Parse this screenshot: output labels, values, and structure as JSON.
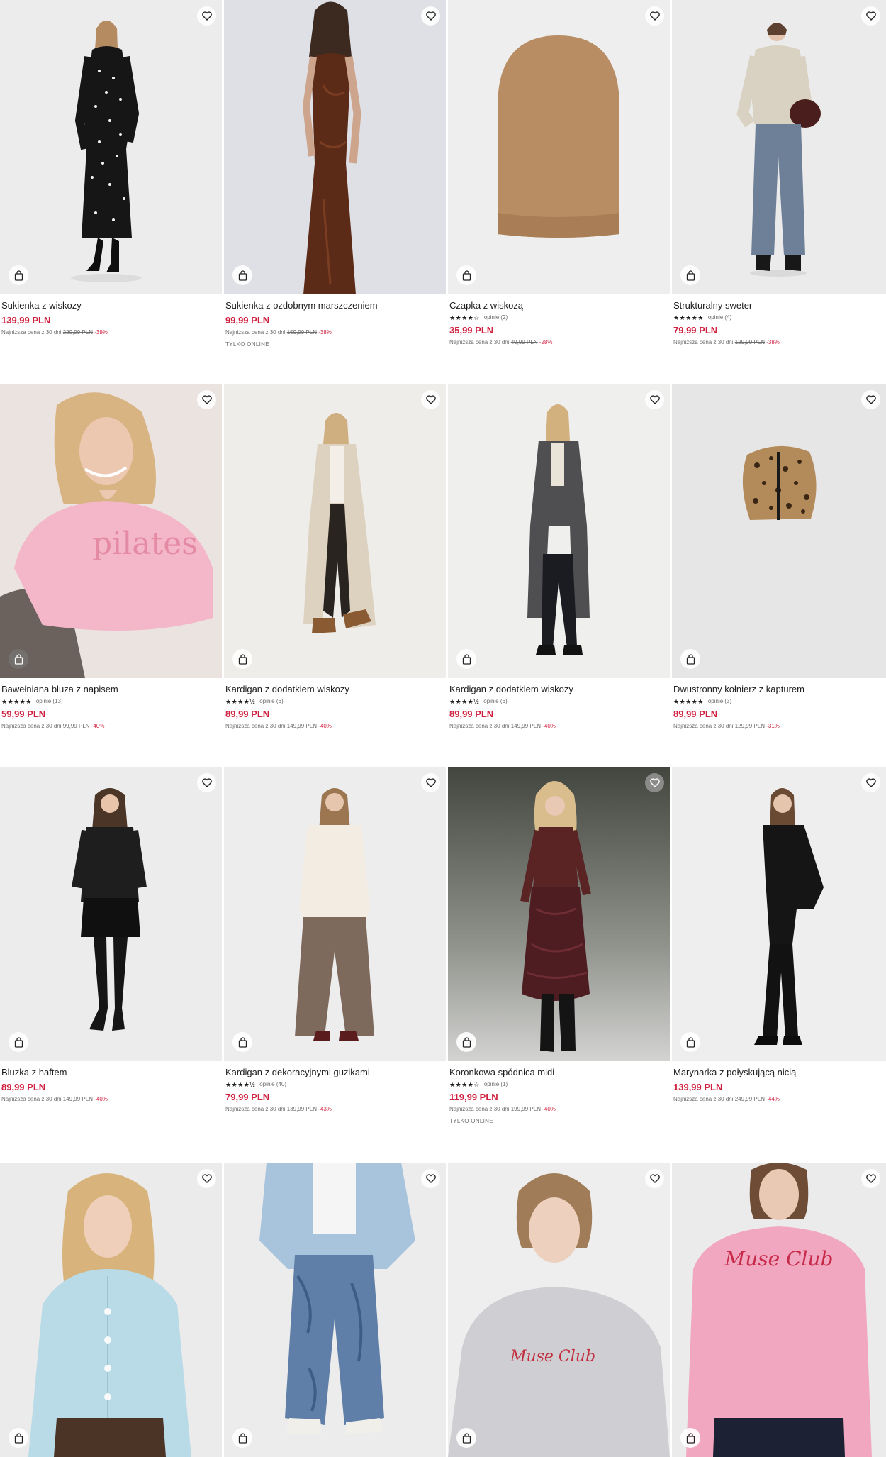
{
  "labels": {
    "lowest_price_prefix": "Najniższa cena z 30 dni",
    "reviews_word": "opinie"
  },
  "products": [
    {
      "name": "Sukienka z wiskozy",
      "price": "139,99 PLN",
      "old_price": "229,99 PLN",
      "discount": "-39%"
    },
    {
      "name": "Sukienka z ozdobnym marszczeniem",
      "price": "99,99 PLN",
      "old_price": "159,99 PLN",
      "discount": "-38%",
      "tag": "TYLKO ONLINE"
    },
    {
      "name": "Czapka z wiskozą",
      "stars": "★★★★☆",
      "rating": 4,
      "reviews": "opinie (2)",
      "price": "35,99 PLN",
      "old_price": "49,99 PLN",
      "discount": "-28%"
    },
    {
      "name": "Strukturalny sweter",
      "stars": "★★★★★",
      "rating": 5,
      "reviews": "opinie (4)",
      "price": "79,99 PLN",
      "old_price": "129,99 PLN",
      "discount": "-38%"
    },
    {
      "name": "Bawełniana bluza z napisem",
      "stars": "★★★★★",
      "rating": 5,
      "reviews": "opinie (13)",
      "price": "59,99 PLN",
      "old_price": "99,99 PLN",
      "discount": "-40%"
    },
    {
      "name": "Kardigan z dodatkiem wiskozy",
      "stars": "★★★★½",
      "rating": 4.5,
      "reviews": "opinie (6)",
      "price": "89,99 PLN",
      "old_price": "149,99 PLN",
      "discount": "-40%"
    },
    {
      "name": "Kardigan z dodatkiem wiskozy",
      "stars": "★★★★½",
      "rating": 4.5,
      "reviews": "opinie (6)",
      "price": "89,99 PLN",
      "old_price": "149,99 PLN",
      "discount": "-40%"
    },
    {
      "name": "Dwustronny kołnierz z kapturem",
      "stars": "★★★★★",
      "rating": 5,
      "reviews": "opinie (3)",
      "price": "89,99 PLN",
      "old_price": "129,99 PLN",
      "discount": "-31%"
    },
    {
      "name": "Bluzka z haftem",
      "price": "89,99 PLN",
      "old_price": "149,99 PLN",
      "discount": "-40%"
    },
    {
      "name": "Kardigan z dekoracyjnymi guzikami",
      "stars": "★★★★½",
      "rating": 4.5,
      "reviews": "opinie (40)",
      "price": "79,99 PLN",
      "old_price": "139,99 PLN",
      "discount": "-43%"
    },
    {
      "name": "Koronkowa spódnica midi",
      "stars": "★★★★☆",
      "rating": 4,
      "reviews": "opinie (1)",
      "price": "119,99 PLN",
      "old_price": "199,99 PLN",
      "discount": "-40%",
      "tag": "TYLKO ONLINE"
    },
    {
      "name": "Marynarka z połyskującą nicią",
      "price": "139,99 PLN",
      "old_price": "249,99 PLN",
      "discount": "-44%"
    },
    {
      "name": "",
      "price": "",
      "old_price": "",
      "discount": ""
    },
    {
      "name": "",
      "price": "",
      "old_price": "",
      "discount": ""
    },
    {
      "name": "",
      "price": "",
      "old_price": "",
      "discount": ""
    },
    {
      "name": "",
      "price": "",
      "old_price": "",
      "discount": ""
    }
  ],
  "image_text": {
    "pilates": "pilates",
    "muse_club": "Muse Club"
  },
  "colors": {
    "price_red": "#cf1f3e",
    "text_dark": "#1d1d1d",
    "text_gray": "#6d6d6d"
  },
  "icons": {
    "favorite": "heart-icon",
    "add_to_bag": "shopping-bag-icon"
  }
}
